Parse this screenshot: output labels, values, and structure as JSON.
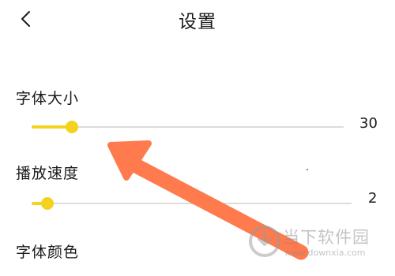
{
  "header": {
    "title": "设置",
    "back_icon": "chevron-left-icon"
  },
  "settings": {
    "font_size": {
      "label": "字体大小",
      "value": "30",
      "level": 0.13
    },
    "playback_speed": {
      "label": "播放速度",
      "value": "2",
      "level": 0.05
    },
    "font_color": {
      "label": "字体颜色"
    }
  },
  "colors": {
    "accent": "#f5d21e",
    "track": "#dcdcdc",
    "annotation_arrow": "#ff7a4d"
  },
  "watermark": {
    "brand": "当下软件园",
    "url": "www.downxia.com"
  }
}
